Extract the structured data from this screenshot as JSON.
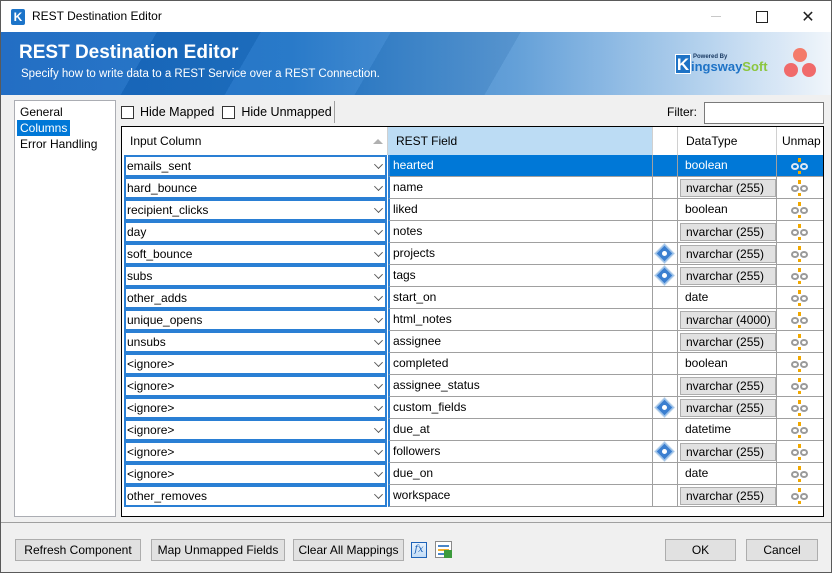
{
  "window": {
    "title": "REST Destination Editor",
    "app_icon_letter": "K",
    "controls": {
      "minimize": "minimize",
      "maximize": "maximize",
      "close": "✕"
    }
  },
  "banner": {
    "title": "REST Destination Editor",
    "subtitle": "Specify how to write data to a REST Service over a REST Connection.",
    "logo": {
      "powered_by": "Powered By",
      "k": "K",
      "ingsway": "ingsway",
      "soft": "Soft"
    }
  },
  "nav": {
    "items": [
      {
        "label": "General",
        "active": false
      },
      {
        "label": "Columns",
        "active": true
      },
      {
        "label": "Error Handling",
        "active": false
      }
    ]
  },
  "toolbar": {
    "hide_mapped_label": "Hide Mapped",
    "hide_mapped_checked": false,
    "hide_unmapped_label": "Hide Unmapped",
    "hide_unmapped_checked": false,
    "filter_label": "Filter:",
    "filter_value": ""
  },
  "grid": {
    "columns": {
      "input": "Input Column",
      "field": "REST Field",
      "info": "",
      "type": "DataType",
      "unmap": "Unmap"
    },
    "rows": [
      {
        "input": "emails_sent",
        "field": "hearted",
        "info": false,
        "type": "boolean",
        "type_button": false,
        "selected": true
      },
      {
        "input": "hard_bounce",
        "field": "name",
        "info": false,
        "type": "nvarchar (255)",
        "type_button": true
      },
      {
        "input": "recipient_clicks",
        "field": "liked",
        "info": false,
        "type": "boolean",
        "type_button": false
      },
      {
        "input": "day",
        "field": "notes",
        "info": false,
        "type": "nvarchar (255)",
        "type_button": true
      },
      {
        "input": "soft_bounce",
        "field": "projects",
        "info": true,
        "type": "nvarchar (255)",
        "type_button": true
      },
      {
        "input": "subs",
        "field": "tags",
        "info": true,
        "type": "nvarchar (255)",
        "type_button": true
      },
      {
        "input": "other_adds",
        "field": "start_on",
        "info": false,
        "type": "date",
        "type_button": false
      },
      {
        "input": "unique_opens",
        "field": "html_notes",
        "info": false,
        "type": "nvarchar (4000)",
        "type_button": true
      },
      {
        "input": "unsubs",
        "field": "assignee",
        "info": false,
        "type": "nvarchar (255)",
        "type_button": true
      },
      {
        "input": "<ignore>",
        "field": "completed",
        "info": false,
        "type": "boolean",
        "type_button": false
      },
      {
        "input": "<ignore>",
        "field": "assignee_status",
        "info": false,
        "type": "nvarchar (255)",
        "type_button": true
      },
      {
        "input": "<ignore>",
        "field": "custom_fields",
        "info": true,
        "type": "nvarchar (255)",
        "type_button": true
      },
      {
        "input": "<ignore>",
        "field": "due_at",
        "info": false,
        "type": "datetime",
        "type_button": false
      },
      {
        "input": "<ignore>",
        "field": "followers",
        "info": true,
        "type": "nvarchar (255)",
        "type_button": true
      },
      {
        "input": "<ignore>",
        "field": "due_on",
        "info": false,
        "type": "date",
        "type_button": false
      },
      {
        "input": "other_removes",
        "field": "workspace",
        "info": false,
        "type": "nvarchar (255)",
        "type_button": true
      }
    ]
  },
  "footer": {
    "refresh": "Refresh Component",
    "map_unmapped": "Map Unmapped Fields",
    "clear_all": "Clear All Mappings",
    "fx_icon": "fx",
    "ok": "OK",
    "cancel": "Cancel"
  }
}
